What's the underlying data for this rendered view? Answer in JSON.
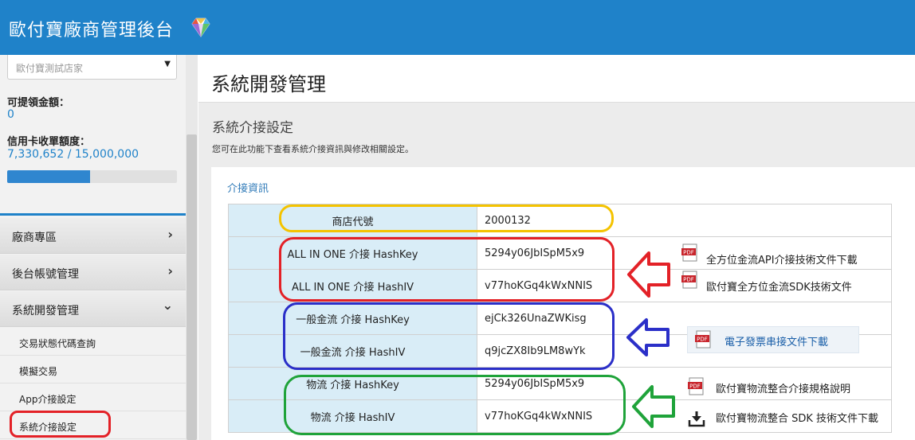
{
  "header": {
    "app_title": "歐付寶廠商管理後台",
    "logo_icon": "diamond-icon"
  },
  "sidebar": {
    "store_select_value": "歐付寶測試店家",
    "withdrawable_label": "可提領金額：",
    "withdrawable_value": "0",
    "credit_label": "信用卡收單額度：",
    "credit_value": "7,330,652 / 15,000,000",
    "credit_progress_fraction": 0.49,
    "menu": [
      {
        "label": "廠商專區",
        "chevron": "›"
      },
      {
        "label": "後台帳號管理",
        "chevron": "›"
      },
      {
        "label": "系統開發管理",
        "chevron": "⌄"
      }
    ],
    "submenu": [
      {
        "label": "交易狀態代碼查詢"
      },
      {
        "label": "模擬交易"
      },
      {
        "label": "App介接設定"
      },
      {
        "label": "系統介接設定"
      }
    ]
  },
  "main": {
    "page_title": "系統開發管理",
    "section_title": "系統介接設定",
    "section_desc": "您可在此功能下查看系統介接資訊與修改相關設定。",
    "panel_title": "介接資訊",
    "rows": [
      {
        "key": "商店代號",
        "value": "2000132"
      },
      {
        "key": "ALL IN ONE 介接 HashKey",
        "value": "5294y06JbISpM5x9"
      },
      {
        "key": "ALL IN ONE 介接 HashIV",
        "value": "v77hoKGq4kWxNNIS"
      },
      {
        "key": "一般金流 介接 HashKey",
        "value": "ejCk326UnaZWKisg"
      },
      {
        "key": "一般金流 介接 HashIV",
        "value": "q9jcZX8Ib9LM8wYk"
      },
      {
        "key": "物流 介接 HashKey",
        "value": "5294y06JbISpM5x9"
      },
      {
        "key": "物流 介接 HashIV",
        "value": "v77hoKGq4kWxNNIS"
      }
    ],
    "docs": {
      "allinone_api": "全方位金流API介接技術文件下載",
      "allinone_sdk": "歐付寶全方位金流SDK技術文件",
      "einvoice": "電子發票串接文件下載",
      "logistics_spec": "歐付寶物流整合介接規格說明",
      "logistics_sdk": "歐付寶物流整合 SDK 技術文件下載"
    },
    "pdf_badge": "PDF"
  },
  "colors": {
    "header_bg": "#1f82c9",
    "yellow": "#f4c300",
    "red": "#e32127",
    "blue": "#2b2fc8",
    "green": "#1fa33a"
  }
}
